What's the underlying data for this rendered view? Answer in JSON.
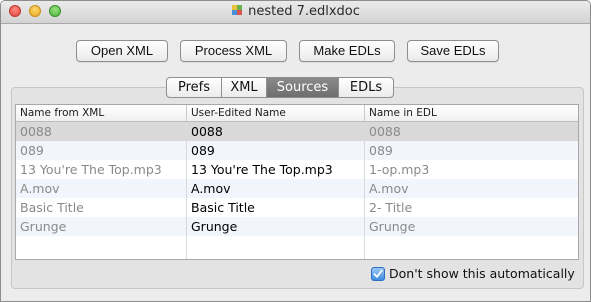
{
  "window": {
    "title": "nested 7.edlxdoc"
  },
  "toolbar": {
    "open_xml": "Open XML",
    "process_xml": "Process XML",
    "make_edls": "Make EDLs",
    "save_edls": "Save EDLs"
  },
  "tabs": {
    "items": [
      {
        "label": "Prefs"
      },
      {
        "label": "XML"
      },
      {
        "label": "Sources"
      },
      {
        "label": "EDLs"
      }
    ],
    "active": "Sources"
  },
  "table": {
    "columns": [
      "Name from XML",
      "User-Edited Name",
      "Name in EDL"
    ],
    "rows": [
      {
        "xml": "0088",
        "user": "0088",
        "edl": "0088",
        "selected": true
      },
      {
        "xml": "089",
        "user": "089",
        "edl": "089",
        "selected": false
      },
      {
        "xml": "13 You're The Top.mp3",
        "user": "13 You're The Top.mp3",
        "edl": "1-op.mp3",
        "selected": false
      },
      {
        "xml": "A.mov",
        "user": "A.mov",
        "edl": "A.mov",
        "selected": false
      },
      {
        "xml": "Basic Title",
        "user": "Basic Title",
        "edl": "2- Title",
        "selected": false
      },
      {
        "xml": "Grunge",
        "user": "Grunge",
        "edl": "Grunge",
        "selected": false
      }
    ]
  },
  "footer": {
    "checkbox_label": "Don't show this automatically",
    "checked": true
  },
  "colors": {
    "window_bg": "#ececec",
    "selected_row": "#d9d9d9",
    "alt_row": "#f2f5fb",
    "active_tab": "#7a7a7a",
    "checkbox_accent": "#3f8de0"
  }
}
